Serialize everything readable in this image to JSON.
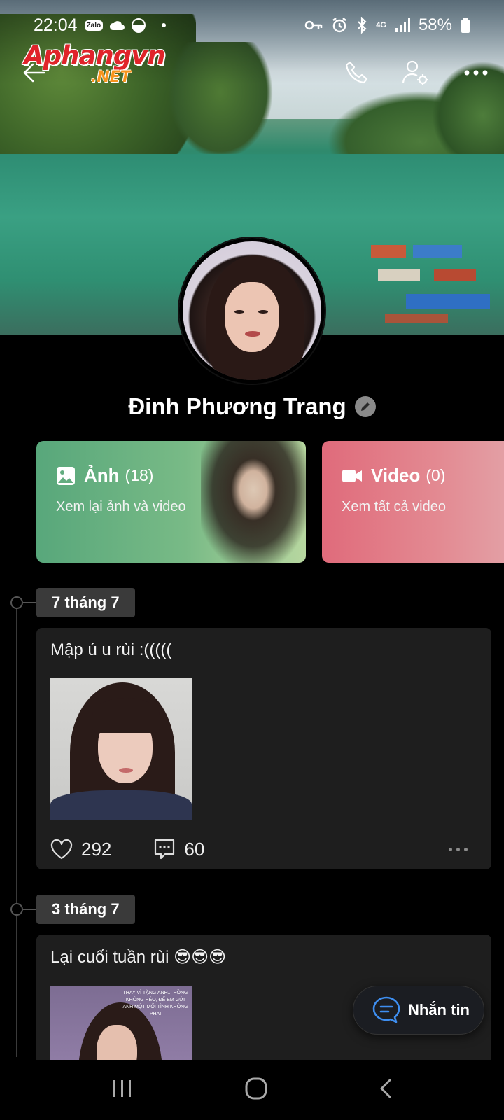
{
  "status_bar": {
    "time": "22:04",
    "zalo_badge": "Zalo",
    "network": "4G",
    "battery": "58%",
    "icons": [
      "zalo-icon",
      "cloud-icon",
      "data-saver-icon",
      "dot-icon",
      "vpn-key-icon",
      "alarm-icon",
      "bluetooth-icon",
      "4g-icon",
      "signal-icon",
      "battery-icon"
    ]
  },
  "watermark": {
    "main": "Aphangvn",
    "sub": ".NET"
  },
  "header": {
    "icons": [
      "back-arrow-icon",
      "phone-icon",
      "user-settings-icon",
      "more-icon"
    ]
  },
  "profile": {
    "name": "Đinh Phương Trang"
  },
  "media_cards": [
    {
      "title": "Ảnh",
      "count": "(18)",
      "subtitle": "Xem lại ảnh và video",
      "icon": "photo-icon"
    },
    {
      "title": "Video",
      "count": "(0)",
      "subtitle": "Xem tất cả video",
      "icon": "video-camera-icon"
    }
  ],
  "posts": [
    {
      "date": "7 tháng 7",
      "text": "Mập ú u rùi :(((((",
      "likes": "292",
      "comments": "60"
    },
    {
      "date": "3 tháng 7",
      "text": "Lại cuối tuần rùi 😎😎😎",
      "image_caption": "THAY VÌ TẶNG ANH... HỒNG KHÔNG HÉO, ĐỂ EM GỬI ANH MỘT MỐI TÌNH KHÔNG PHAI"
    }
  ],
  "message_button": {
    "label": "Nhắn tin"
  },
  "nav_bar": {
    "icons": [
      "recent-apps-icon",
      "home-icon",
      "back-icon"
    ]
  },
  "colors": {
    "photo_card": "#6cb383",
    "video_card": "#e27a86",
    "background": "#000000",
    "post_bg": "#1e1e1e"
  }
}
